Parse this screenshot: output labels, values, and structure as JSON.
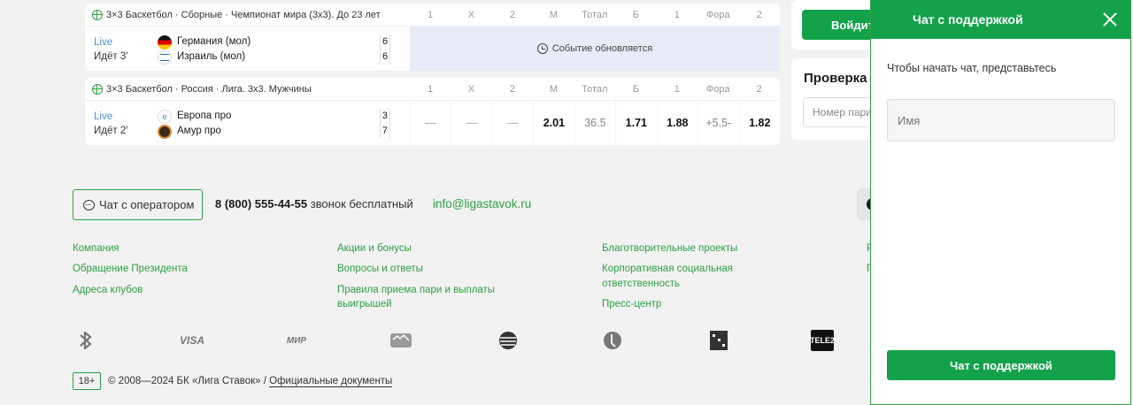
{
  "odds_headers": [
    "1",
    "X",
    "2",
    "М",
    "Тотал",
    "Б",
    "1",
    "Фора",
    "2"
  ],
  "events": [
    {
      "league": "3×3 Баскетбол · Сборные · Чемпионат мира (3х3). До 23 лет",
      "live": "Live",
      "time": "Идёт 3′",
      "team1": "Германия (мол)",
      "team2": "Израиль (мол)",
      "score1": "6",
      "score2": "6",
      "updating_text": "Событие обновляется"
    },
    {
      "league": "3×3 Баскетбол · Россия · Лига. 3х3. Мужчины",
      "live": "Live",
      "time": "Идёт 2′",
      "team1": "Европа про",
      "team2": "Амур про",
      "score1": "3",
      "score2": "7",
      "odds": [
        "—",
        "—",
        "—",
        "2.01",
        "36.5",
        "1.71",
        "1.88",
        "+5.5-",
        "1.82"
      ]
    }
  ],
  "sidebar": {
    "login_label": "Войдите",
    "check_title": "Проверка",
    "check_placeholder": "Номер пари"
  },
  "footer": {
    "operator_button": "Чат с оператором",
    "phone": "8 (800) 555-44-55",
    "phone_note": "звонок бесплатный",
    "email": "info@ligastavok.ru",
    "links_col1": [
      "Компания",
      "Обращение Президента",
      "Адреса клубов"
    ],
    "links_col2": [
      "Акции и бонусы",
      "Вопросы и ответы",
      "Правила приема пари и выплаты выигрышей"
    ],
    "links_col3": [
      "Благотворительные проекты",
      "Корпоративная социальная ответственность",
      "Пресс-центр"
    ],
    "links_col4": [
      "Р",
      "П"
    ],
    "payments": [
      "VISA",
      "МИР",
      "TELE2"
    ],
    "age": "18+",
    "copyright": "© 2008—2024 БК «Лига Ставок» /",
    "docs_link": "Официальные документы"
  },
  "chat": {
    "title": "Чат с поддержкой",
    "intro": "Чтобы начать чат, представьтесь",
    "name_placeholder": "Имя",
    "submit": "Чат с поддержкой"
  },
  "colors": {
    "brand_green": "#13a24a",
    "link_green": "#2ea043",
    "live_blue": "#4a90e2",
    "updating_bg": "#e8ecf8"
  }
}
